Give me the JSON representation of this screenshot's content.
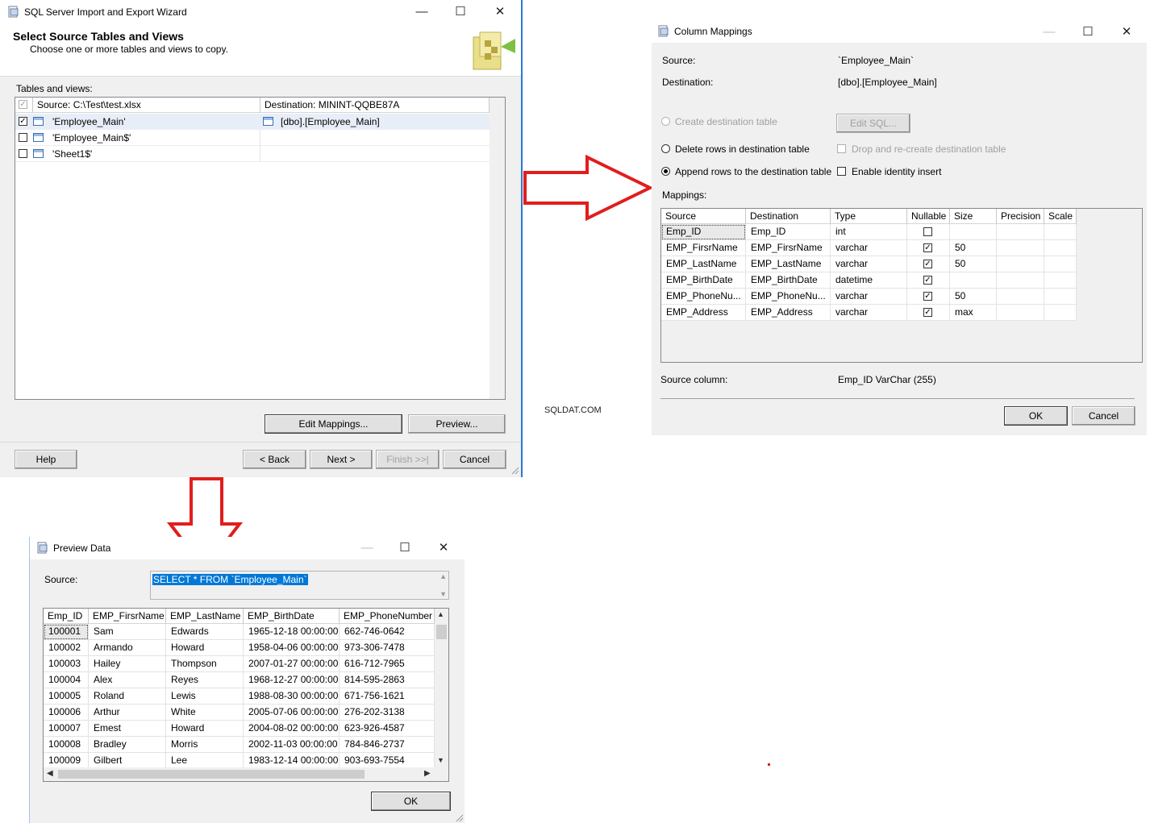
{
  "watermark": "SQLDAT.COM",
  "wizard": {
    "title": "SQL Server Import and Export Wizard",
    "heading": "Select Source Tables and Views",
    "subheading": "Choose one or more tables and views to copy.",
    "tables_label": "Tables and views:",
    "columns": [
      "Source: C:\\Test\\test.xlsx",
      "Destination: MININT-QQBE87A"
    ],
    "rows": [
      {
        "checked": true,
        "source": "'Employee_Main'",
        "destination": "[dbo].[Employee_Main]"
      },
      {
        "checked": false,
        "source": "'Employee_Main$'",
        "destination": ""
      },
      {
        "checked": false,
        "source": "'Sheet1$'",
        "destination": ""
      }
    ],
    "edit_mappings": "Edit Mappings...",
    "preview": "Preview...",
    "help": "Help",
    "back": "< Back",
    "next": "Next >",
    "finish": "Finish >>|",
    "cancel": "Cancel",
    "icons": {
      "minimize": "—",
      "maximize": "☐",
      "close": "✕"
    }
  },
  "mappings": {
    "title": "Column Mappings",
    "source_label": "Source:",
    "source_value": "`Employee_Main`",
    "destination_label": "Destination:",
    "destination_value": "[dbo].[Employee_Main]",
    "create_table": "Create destination table",
    "edit_sql": "Edit SQL...",
    "delete_rows": "Delete rows in destination table",
    "drop_recreate": "Drop and re-create destination table",
    "append_rows": "Append rows to the destination table",
    "identity_insert": "Enable identity insert",
    "mappings_label": "Mappings:",
    "columns": [
      "Source",
      "Destination",
      "Type",
      "Nullable",
      "Size",
      "Precision",
      "Scale"
    ],
    "rows": [
      {
        "source": "Emp_ID",
        "destination": "Emp_ID",
        "type": "int",
        "nullable": false,
        "size": "",
        "precision": "",
        "scale": ""
      },
      {
        "source": "EMP_FirsrName",
        "destination": "EMP_FirsrName",
        "type": "varchar",
        "nullable": true,
        "size": "50",
        "precision": "",
        "scale": ""
      },
      {
        "source": "EMP_LastName",
        "destination": "EMP_LastName",
        "type": "varchar",
        "nullable": true,
        "size": "50",
        "precision": "",
        "scale": ""
      },
      {
        "source": "EMP_BirthDate",
        "destination": "EMP_BirthDate",
        "type": "datetime",
        "nullable": true,
        "size": "",
        "precision": "",
        "scale": ""
      },
      {
        "source": "EMP_PhoneNu...",
        "destination": "EMP_PhoneNu...",
        "type": "varchar",
        "nullable": true,
        "size": "50",
        "precision": "",
        "scale": ""
      },
      {
        "source": "EMP_Address",
        "destination": "EMP_Address",
        "type": "varchar",
        "nullable": true,
        "size": "max",
        "precision": "",
        "scale": ""
      }
    ],
    "source_column_label": "Source column:",
    "source_column_value": "Emp_ID VarChar (255)",
    "ok": "OK",
    "cancel": "Cancel"
  },
  "preview": {
    "title": "Preview Data",
    "source_label": "Source:",
    "query": "SELECT * FROM `Employee_Main`",
    "columns": [
      "Emp_ID",
      "EMP_FirsrName",
      "EMP_LastName",
      "EMP_BirthDate",
      "EMP_PhoneNumber"
    ],
    "rows": [
      [
        "100001",
        "Sam",
        "Edwards",
        "1965-12-18 00:00:00",
        "662-746-0642"
      ],
      [
        "100002",
        "Armando",
        "Howard",
        "1958-04-06 00:00:00",
        "973-306-7478"
      ],
      [
        "100003",
        "Hailey",
        "Thompson",
        "2007-01-27 00:00:00",
        "616-712-7965"
      ],
      [
        "100004",
        "Alex",
        "Reyes",
        "1968-12-27 00:00:00",
        "814-595-2863"
      ],
      [
        "100005",
        "Roland",
        "Lewis",
        "1988-08-30 00:00:00",
        "671-756-1621"
      ],
      [
        "100006",
        "Arthur",
        "White",
        "2005-07-06 00:00:00",
        "276-202-3138"
      ],
      [
        "100007",
        "Emest",
        "Howard",
        "2004-08-02 00:00:00",
        "623-926-4587"
      ],
      [
        "100008",
        "Bradley",
        "Morris",
        "2002-11-03 00:00:00",
        "784-846-2737"
      ],
      [
        "100009",
        "Gilbert",
        "Lee",
        "1983-12-14 00:00:00",
        "903-693-7554"
      ]
    ],
    "ok": "OK"
  },
  "colors": {
    "accent_border": "#2b78d4",
    "arrow": "#e21d1d",
    "selection": "#0078d7"
  }
}
